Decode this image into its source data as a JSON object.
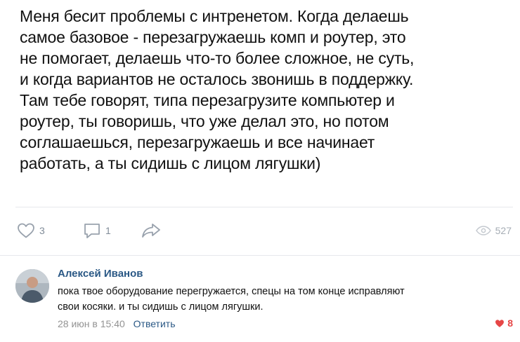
{
  "post": {
    "lines": [
      "Меня бесит проблемы с интренетом. Когда делаешь",
      "самое базовое - перезагружаешь комп и роутер, это",
      "не помогает, делаешь что-то более сложное, не суть,",
      "и когда вариантов не осталось звонишь в поддержку.",
      "Там тебе говорят, типа перезагрузите компьютер и",
      "роутер, ты говоришь, что уже делал это, но потом",
      "соглашаешься, перезагружаешь и все начинает",
      "работать, а ты сидишь с лицом лягушки)"
    ]
  },
  "actions": {
    "likes": "3",
    "comments": "1",
    "views": "527",
    "icons": [
      "heart-outline-icon",
      "comment-icon",
      "share-arrow-icon",
      "eye-icon"
    ]
  },
  "comment": {
    "author": "Алексей Иванов",
    "lines": [
      "пока твое оборудование перегружается, спецы на том конце исправляют",
      "свои косяки. и ты сидишь с лицом лягушки."
    ],
    "date": "28 июн в 15:40",
    "reply_label": "Ответить",
    "likes": "8"
  },
  "colors": {
    "link": "#2a5885",
    "muted": "#818c99",
    "like_active": "#e64646"
  }
}
